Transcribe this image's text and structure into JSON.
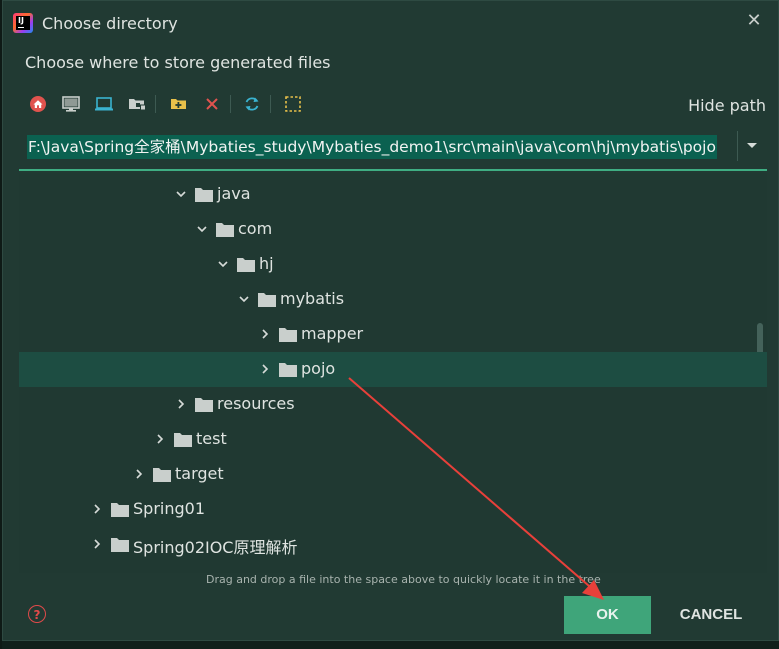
{
  "dialog": {
    "title": "Choose directory",
    "subtitle": "Choose where to store generated files",
    "close_icon": "close-icon"
  },
  "toolbar": {
    "icons": [
      "home-icon",
      "desktop-icon",
      "project-icon",
      "module-icon",
      "new-folder-icon",
      "delete-icon",
      "refresh-icon",
      "toggle-hidden-icon"
    ],
    "hide_path_label": "Hide path"
  },
  "path": {
    "value": "F:\\Java\\Spring全家桶\\Mybaties_study\\Mybaties_demo1\\src\\main\\java\\com\\hj\\mybatis\\pojo"
  },
  "tree": {
    "items": [
      {
        "label": "java",
        "expanded": true
      },
      {
        "label": "com",
        "expanded": true
      },
      {
        "label": "hj",
        "expanded": true
      },
      {
        "label": "mybatis",
        "expanded": true
      },
      {
        "label": "mapper",
        "expanded": false
      },
      {
        "label": "pojo",
        "expanded": false,
        "selected": true
      },
      {
        "label": "resources",
        "expanded": false
      },
      {
        "label": "test",
        "expanded": false
      },
      {
        "label": "target",
        "expanded": false
      },
      {
        "label": "Spring01",
        "expanded": false
      },
      {
        "label": "Spring02IOC原理解析",
        "expanded": false
      }
    ]
  },
  "hint": "Drag and drop a file into the space above to quickly locate it in the tree",
  "buttons": {
    "ok": "OK",
    "cancel": "CANCEL",
    "help": "?"
  },
  "colors": {
    "dialog_bg": "#213a33",
    "accent": "#3fa57a",
    "selection": "#1d4d42",
    "path_highlight": "#0b6150",
    "annotation_arrow": "#e8403a"
  }
}
